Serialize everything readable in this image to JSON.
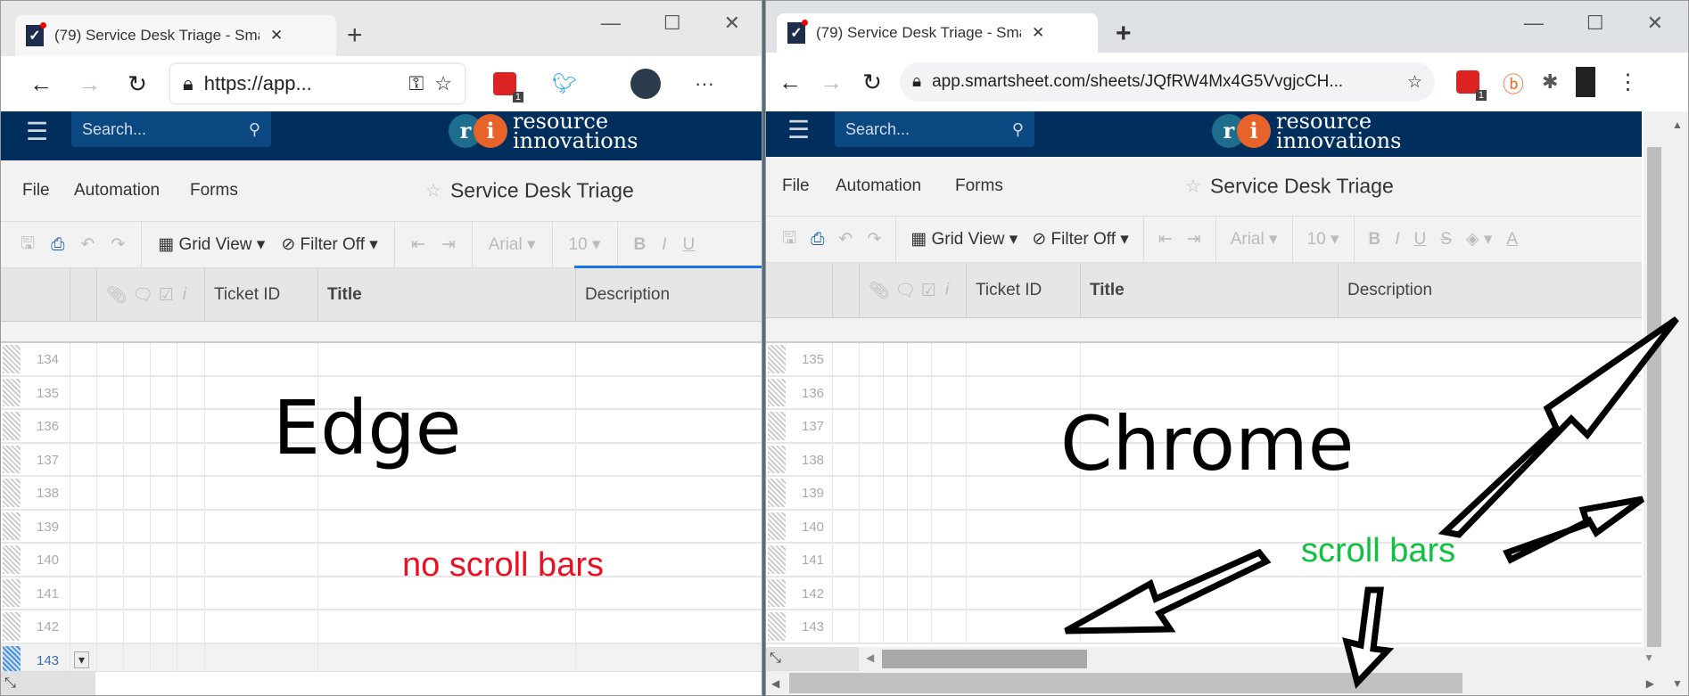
{
  "edge": {
    "tab_title": "(79) Service Desk Triage - Smartsheet",
    "url": "https://app...",
    "extension_badge": "1",
    "search_placeholder": "Search...",
    "logo_text": [
      "resource",
      "innovations"
    ],
    "menu": [
      "File",
      "Automation",
      "Forms"
    ],
    "sheet_title": "Service Desk Triage",
    "toolbar": {
      "grid_view": "Grid View",
      "filter": "Filter Off",
      "font": "Arial",
      "size": "10",
      "bold": "B",
      "italic": "I",
      "underline": "U"
    },
    "columns": [
      "Ticket ID",
      "Title",
      "Description"
    ],
    "rows": [
      "134",
      "135",
      "136",
      "137",
      "138",
      "139",
      "140",
      "141",
      "142",
      "143"
    ],
    "selected_row": "143",
    "annotation": "Edge",
    "note": "no scroll bars"
  },
  "chrome": {
    "tab_title": "(79) Service Desk Triage - Smartsheet",
    "url": "app.smartsheet.com/sheets/JQfRW4Mx4G5VvgjcCH...",
    "extension_badge": "1",
    "search_placeholder": "Search...",
    "logo_text": [
      "resource",
      "innovations"
    ],
    "menu": [
      "File",
      "Automation",
      "Forms"
    ],
    "sheet_title": "Service Desk Triage",
    "toolbar": {
      "grid_view": "Grid View",
      "filter": "Filter Off",
      "font": "Arial",
      "size": "10",
      "bold": "B",
      "italic": "I",
      "underline": "U",
      "strike": "S",
      "text_color": "A"
    },
    "columns": [
      "Ticket ID",
      "Title",
      "Description"
    ],
    "rows": [
      "135",
      "136",
      "137",
      "138",
      "139",
      "140",
      "141",
      "142",
      "143"
    ],
    "annotation": "Chrome",
    "note": "scroll bars"
  },
  "colors": {
    "header": "#002e5d",
    "note_red": "#e81123",
    "note_green": "#10c040"
  }
}
